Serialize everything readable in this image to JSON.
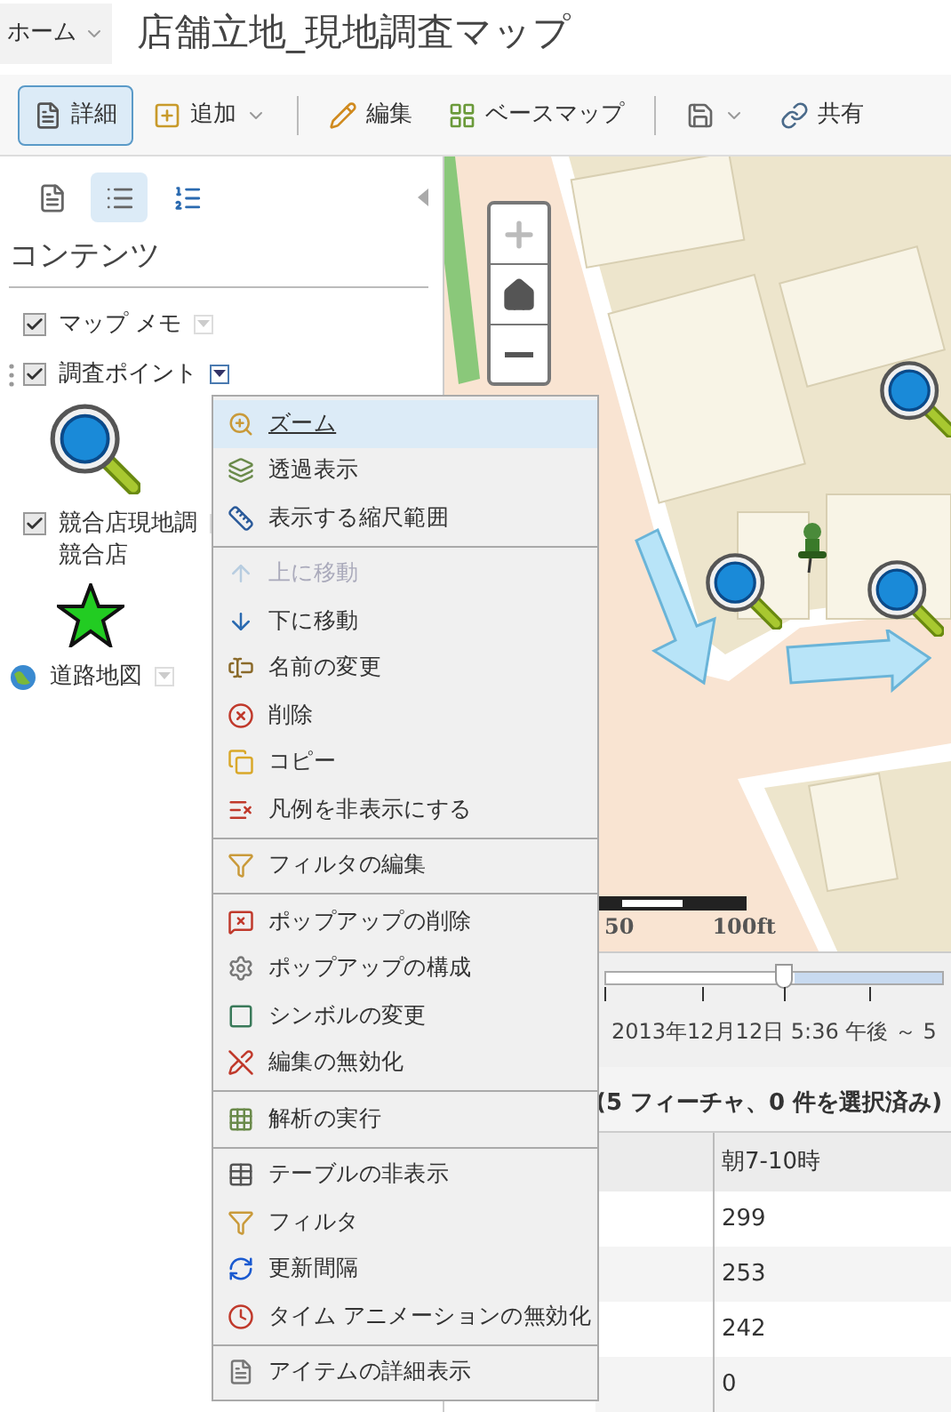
{
  "header": {
    "home_menu": "ホーム",
    "title": "店舗立地_現地調査マップ"
  },
  "toolbar": [
    {
      "kind": "button",
      "label": "詳細",
      "selected": true,
      "caret": false
    },
    {
      "kind": "button",
      "label": "追加",
      "selected": false,
      "caret": true
    },
    {
      "kind": "separator"
    },
    {
      "kind": "button",
      "label": "編集",
      "selected": false,
      "caret": false
    },
    {
      "kind": "button",
      "label": "ベースマップ",
      "selected": false,
      "caret": false
    },
    {
      "kind": "separator"
    },
    {
      "kind": "icon-button",
      "selected": false,
      "caret": true
    },
    {
      "kind": "button",
      "label": "共有",
      "selected": false,
      "caret": false
    }
  ],
  "panel_tabs": [
    {
      "selected": false
    },
    {
      "selected": true
    },
    {
      "selected": false
    }
  ],
  "contents_title": "コンテンツ",
  "layers": [
    {
      "kind": "notes-layer",
      "name": "マップ メモ",
      "checked": true,
      "menu_open": false
    },
    {
      "kind": "point-layer",
      "name": "調査ポイント",
      "checked": true,
      "menu_open": true,
      "legend": true
    },
    {
      "kind": "store-layer",
      "name": "競合店現地調",
      "sublayer": "競合店",
      "checked": true,
      "menu_open": false,
      "legend": true
    },
    {
      "kind": "basemap",
      "name": "道路地図",
      "menu_open": false
    }
  ],
  "layer_menu": [
    [
      {
        "label": "ズーム",
        "highlighted": true,
        "disabled": false
      },
      {
        "label": "透過表示",
        "highlighted": false,
        "disabled": false
      },
      {
        "label": "表示する縮尺範囲",
        "highlighted": false,
        "disabled": false
      }
    ],
    [
      {
        "label": "上に移動",
        "highlighted": false,
        "disabled": true
      },
      {
        "label": "下に移動",
        "highlighted": false,
        "disabled": false
      },
      {
        "label": "名前の変更",
        "highlighted": false,
        "disabled": false
      },
      {
        "label": "削除",
        "highlighted": false,
        "disabled": false
      },
      {
        "label": "コピー",
        "highlighted": false,
        "disabled": false
      },
      {
        "label": "凡例を非表示にする",
        "highlighted": false,
        "disabled": false
      }
    ],
    [
      {
        "label": "フィルタの編集",
        "highlighted": false,
        "disabled": false
      }
    ],
    [
      {
        "label": "ポップアップの削除",
        "highlighted": false,
        "disabled": false
      },
      {
        "label": "ポップアップの構成",
        "highlighted": false,
        "disabled": false
      },
      {
        "label": "シンボルの変更",
        "highlighted": false,
        "disabled": false
      },
      {
        "label": "編集の無効化",
        "highlighted": false,
        "disabled": false
      }
    ],
    [
      {
        "label": "解析の実行",
        "highlighted": false,
        "disabled": false
      }
    ],
    [
      {
        "label": "テーブルの非表示",
        "highlighted": false,
        "disabled": false
      },
      {
        "label": "フィルタ",
        "highlighted": false,
        "disabled": false
      },
      {
        "label": "更新間隔",
        "highlighted": false,
        "disabled": false
      },
      {
        "label": "タイム アニメーションの無効化",
        "highlighted": false,
        "disabled": false
      }
    ],
    [
      {
        "label": "アイテムの詳細表示",
        "highlighted": false,
        "disabled": false
      }
    ]
  ],
  "scale_bar": {
    "labels": [
      "50",
      "100ft"
    ]
  },
  "time_slider": {
    "level": 0.53,
    "range_text": "2013年12月12日 5:36 午後 ～ 5"
  },
  "table": {
    "title": "(5 フィーチャ、0 件を選択済み)",
    "columns": [
      "",
      "朝7-10時"
    ],
    "rows": [
      [
        "",
        "299"
      ],
      [
        "",
        "253"
      ],
      [
        "",
        "242"
      ],
      [
        "",
        "0"
      ]
    ]
  }
}
